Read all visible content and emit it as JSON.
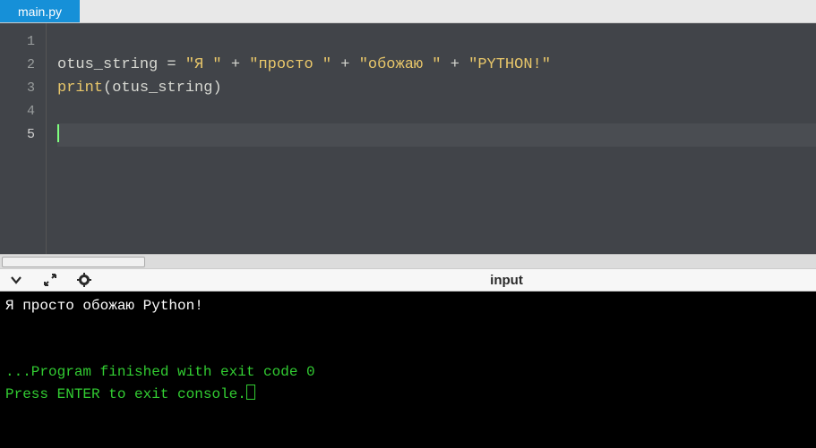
{
  "tab": {
    "filename": "main.py"
  },
  "editor": {
    "line_numbers": [
      "1",
      "2",
      "3",
      "4",
      "5"
    ],
    "active_line": 5,
    "line2": {
      "ident": "otus_string",
      "sp1": " ",
      "eq": "=",
      "sp2": " ",
      "s1": "\"Я \"",
      "sp3": " ",
      "plus1": "+",
      "sp4": " ",
      "s2": "\"просто \"",
      "sp5": " ",
      "plus2": "+",
      "sp6": " ",
      "s3": "\"обожаю \"",
      "sp7": " ",
      "plus3": "+",
      "sp8": " ",
      "s4": "\"PYTHON!\""
    },
    "line3": {
      "fn": "print",
      "lp": "(",
      "arg": "otus_string",
      "rp": ")"
    }
  },
  "toolbar": {
    "panel_label": "input"
  },
  "console": {
    "output_line": "Я просто обожаю Python!",
    "blank": "",
    "blank2": "",
    "finish_line": "...Program finished with exit code 0",
    "prompt_line": "Press ENTER to exit console."
  }
}
